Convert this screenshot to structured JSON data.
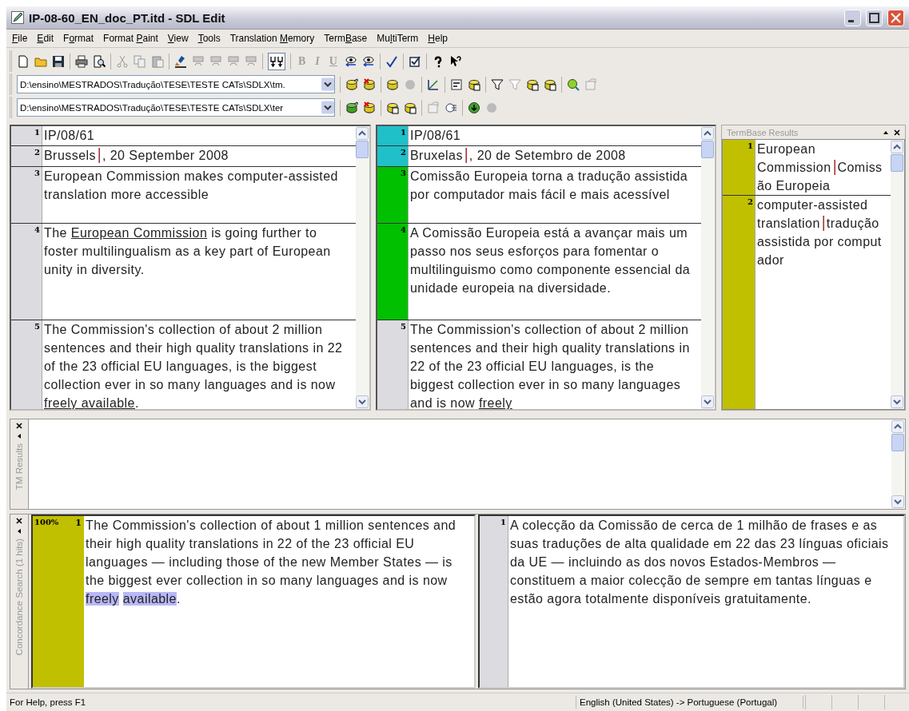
{
  "window": {
    "title": "IP-08-60_EN_doc_PT.itd - SDL Edit"
  },
  "menu": [
    {
      "key": "F",
      "after": "ile"
    },
    {
      "key": "E",
      "after": "dit"
    },
    {
      "before": "F",
      "key": "o",
      "after": "rmat"
    },
    {
      "before": "Format ",
      "key": "P",
      "after": "aint"
    },
    {
      "key": "V",
      "after": "iew"
    },
    {
      "key": "T",
      "after": "ools"
    },
    {
      "before": "Translation ",
      "key": "M",
      "after": "emory"
    },
    {
      "before": "Term",
      "key": "B",
      "after": "ase"
    },
    {
      "before": "Mu",
      "key": "l",
      "after": "tiTerm"
    },
    {
      "key": "H",
      "after": "elp"
    }
  ],
  "toggle_button": {
    "pressed": true
  },
  "format_buttons": [
    {
      "label": "B",
      "disabled": true
    },
    {
      "label": "I",
      "disabled": true
    },
    {
      "label": "U",
      "disabled": true
    }
  ],
  "tm_path": {
    "value": "D:\\ensino\\MESTRADOS\\Tradução\\TESE\\TESTE CATs\\SDLX\\tm."
  },
  "termbase_path": {
    "value": "D:\\ensino\\MESTRADOS\\Tradução\\TESE\\TESTE CATs\\SDLX\\ter"
  },
  "source_segments": [
    {
      "number": "1",
      "parts": [
        {
          "kind": "text",
          "text": "IP/08/61"
        }
      ]
    },
    {
      "number": "2",
      "parts": [
        {
          "kind": "text",
          "text": "Brussels"
        },
        {
          "kind": "tag"
        },
        {
          "kind": "text",
          "text": ", 20 September 2008"
        }
      ]
    },
    {
      "number": "3",
      "parts": [
        {
          "kind": "text",
          "text": "European Commission makes computer-assisted translation more accessible"
        }
      ]
    },
    {
      "number": "4",
      "parts": [
        {
          "kind": "text",
          "text": "The "
        },
        {
          "kind": "underlined",
          "text": "European Commission"
        },
        {
          "kind": "text",
          "text": " is going further to foster multilingualism as a key part of European unity in diversity."
        }
      ]
    },
    {
      "number": "5",
      "parts": [
        {
          "kind": "text",
          "text": "The Commission's collection of about 2 million sentences and their high quality translations in 22 of the 23 official EU languages, is the biggest collection ever in so many languages and is now "
        },
        {
          "kind": "underlined",
          "text": "freely available"
        },
        {
          "kind": "text",
          "text": "."
        }
      ]
    }
  ],
  "target_segments": [
    {
      "number": "1",
      "color": "#20c0c8",
      "parts": [
        {
          "kind": "text",
          "text": "IP/08/61"
        }
      ]
    },
    {
      "number": "2",
      "color": "#20c0c8",
      "parts": [
        {
          "kind": "text",
          "text": "Bruxelas"
        },
        {
          "kind": "tag"
        },
        {
          "kind": "text",
          "text": ", 20 de Setembro de 2008"
        }
      ]
    },
    {
      "number": "3",
      "color": "#00c000",
      "parts": [
        {
          "kind": "text",
          "text": "Comissão Europeia torna a tradução assistida por computador mais fácil e mais acessível"
        }
      ]
    },
    {
      "number": "4",
      "color": "#00c000",
      "parts": [
        {
          "kind": "text",
          "text": "A Comissão Europeia está a avançar mais um passo nos seus esforços para fomentar o multilinguismo como componente essencial da unidade europeia na diversidade."
        }
      ]
    },
    {
      "number": "5",
      "color": "#dcdce0",
      "parts": [
        {
          "kind": "text",
          "text": "The Commission's collection of about 2 million sentences and their high quality translations in 22 of the 23 official EU languages, is the biggest collection ever in so many languages and is now "
        },
        {
          "kind": "underlined",
          "text": "freely"
        }
      ]
    }
  ],
  "termbase": {
    "title": "TermBase Results",
    "hits": [
      {
        "number": "1",
        "source": "European Commission",
        "target": "Comissão Europeia"
      },
      {
        "number": "2",
        "source": "computer-assisted translation",
        "target": "tradução assistida por computador"
      }
    ]
  },
  "tm_results": {
    "label": "TM Results"
  },
  "concordance": {
    "label": "Concordance Search (1 hits)",
    "hits": [
      {
        "score": "100%",
        "number": "1",
        "source": [
          {
            "kind": "text",
            "text": "The Commission's collection of about 1 million sentences and their high quality translations in 22 of the 23 official EU languages — including those of the new Member States — is the biggest ever collection in so many languages and is now "
          },
          {
            "kind": "highlighted",
            "text": "freely"
          },
          {
            "kind": "space"
          },
          {
            "kind": "highlighted",
            "text": "available"
          },
          {
            "kind": "text",
            "text": "."
          }
        ],
        "target_number": "1",
        "target": "A colecção da Comissão de cerca de 1 milhão de frases e as suas traduções de alta qualidade em 22 das 23 línguas oficiais da UE — incluindo as dos novos Estados-Membros — constituem a maior colecção de sempre em tantas línguas e estão agora totalmente disponíveis gratuitamente."
      }
    ]
  },
  "status_bar": {
    "help": "For Help, press F1",
    "languages": "English (United States) -> Portuguese (Portugal)"
  }
}
